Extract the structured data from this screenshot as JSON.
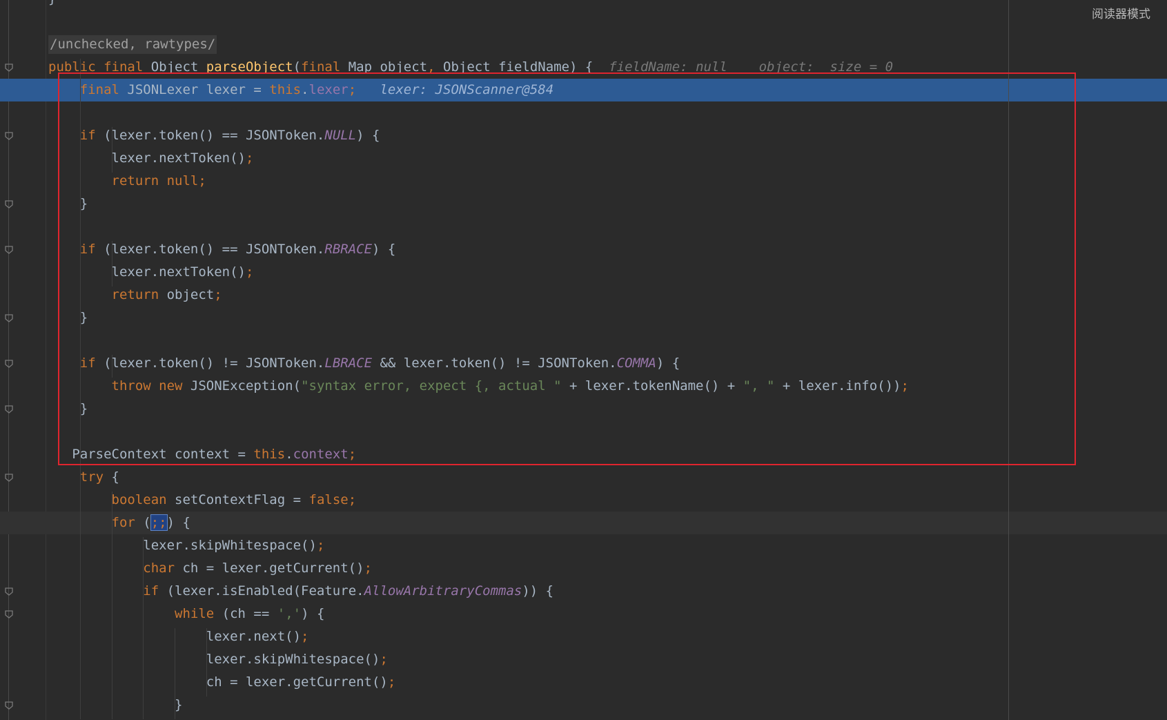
{
  "editor": {
    "reader_mode_label": "阅读器模式",
    "lines": [
      {
        "tokens": [
          {
            "t": "}",
            "c": ""
          }
        ]
      },
      {
        "tokens": []
      },
      {
        "annotation": "/unchecked, rawtypes/"
      },
      {
        "tokens": [
          {
            "t": "public final ",
            "c": "kw"
          },
          {
            "t": "Object ",
            "c": ""
          },
          {
            "t": "parseObject",
            "c": "fn"
          },
          {
            "t": "(",
            "c": ""
          },
          {
            "t": "final ",
            "c": "kw"
          },
          {
            "t": "Map object",
            "c": ""
          },
          {
            "t": ", ",
            "c": "kw"
          },
          {
            "t": "Object fieldName) {",
            "c": ""
          },
          {
            "t": "  fieldName: null    object:  size = 0",
            "c": "inl"
          }
        ]
      },
      {
        "highlight": "exec",
        "tokens": [
          {
            "t": "    final ",
            "c": "kw"
          },
          {
            "t": "JSONLexer lexer = ",
            "c": ""
          },
          {
            "t": "this",
            "c": "kw"
          },
          {
            "t": ".",
            "c": ""
          },
          {
            "t": "lexer",
            "c": "fld"
          },
          {
            "t": ";",
            "c": "kw"
          },
          {
            "t": "   lexer: JSONScanner@584",
            "c": "inl"
          }
        ]
      },
      {
        "tokens": []
      },
      {
        "tokens": [
          {
            "t": "    if ",
            "c": "kw"
          },
          {
            "t": "(lexer.token() == JSONToken.",
            "c": ""
          },
          {
            "t": "NULL",
            "c": "cst"
          },
          {
            "t": ") {",
            "c": ""
          }
        ]
      },
      {
        "tokens": [
          {
            "t": "        lexer.nextToken()",
            "c": ""
          },
          {
            "t": ";",
            "c": "kw"
          }
        ]
      },
      {
        "tokens": [
          {
            "t": "        return null;",
            "c": "kw"
          }
        ]
      },
      {
        "tokens": [
          {
            "t": "    }",
            "c": ""
          }
        ]
      },
      {
        "tokens": []
      },
      {
        "tokens": [
          {
            "t": "    if ",
            "c": "kw"
          },
          {
            "t": "(lexer.token() == JSONToken.",
            "c": ""
          },
          {
            "t": "RBRACE",
            "c": "cst"
          },
          {
            "t": ") {",
            "c": ""
          }
        ]
      },
      {
        "tokens": [
          {
            "t": "        lexer.nextToken()",
            "c": ""
          },
          {
            "t": ";",
            "c": "kw"
          }
        ]
      },
      {
        "tokens": [
          {
            "t": "        return ",
            "c": "kw"
          },
          {
            "t": "object",
            "c": ""
          },
          {
            "t": ";",
            "c": "kw"
          }
        ]
      },
      {
        "tokens": [
          {
            "t": "    }",
            "c": ""
          }
        ]
      },
      {
        "tokens": []
      },
      {
        "tokens": [
          {
            "t": "    if ",
            "c": "kw"
          },
          {
            "t": "(lexer.token() != JSONToken.",
            "c": ""
          },
          {
            "t": "LBRACE",
            "c": "cst"
          },
          {
            "t": " && lexer.token() != JSONToken.",
            "c": ""
          },
          {
            "t": "COMMA",
            "c": "cst"
          },
          {
            "t": ") {",
            "c": ""
          }
        ]
      },
      {
        "tokens": [
          {
            "t": "        throw new ",
            "c": "kw"
          },
          {
            "t": "JSONException(",
            "c": ""
          },
          {
            "t": "\"syntax error, expect {, actual \"",
            "c": "str"
          },
          {
            "t": " + lexer.tokenName() + ",
            "c": ""
          },
          {
            "t": "\", \"",
            "c": "str"
          },
          {
            "t": " + lexer.info())",
            "c": ""
          },
          {
            "t": ";",
            "c": "kw"
          }
        ]
      },
      {
        "tokens": [
          {
            "t": "    }",
            "c": ""
          }
        ]
      },
      {
        "tokens": []
      },
      {
        "tokens": [
          {
            "t": "   ParseContext context = ",
            "c": ""
          },
          {
            "t": "this",
            "c": "kw"
          },
          {
            "t": ".",
            "c": ""
          },
          {
            "t": "context",
            "c": "fld"
          },
          {
            "t": ";",
            "c": "kw"
          }
        ]
      },
      {
        "tokens": [
          {
            "t": "    try ",
            "c": "kw"
          },
          {
            "t": "{",
            "c": ""
          }
        ]
      },
      {
        "tokens": [
          {
            "t": "        boolean ",
            "c": "kw"
          },
          {
            "t": "setContextFlag = ",
            "c": ""
          },
          {
            "t": "false;",
            "c": "kw"
          }
        ]
      },
      {
        "highlight": "caret",
        "tokens": [
          {
            "t": "        for ",
            "c": "kw"
          },
          {
            "t": "(",
            "c": ""
          },
          {
            "t": ";;",
            "c": "kw sel"
          },
          {
            "t": ") {",
            "c": ""
          }
        ]
      },
      {
        "tokens": [
          {
            "t": "            lexer.skipWhitespace()",
            "c": ""
          },
          {
            "t": ";",
            "c": "kw"
          }
        ]
      },
      {
        "tokens": [
          {
            "t": "            char ",
            "c": "kw"
          },
          {
            "t": "ch = lexer.getCurrent()",
            "c": ""
          },
          {
            "t": ";",
            "c": "kw"
          }
        ]
      },
      {
        "tokens": [
          {
            "t": "            if ",
            "c": "kw"
          },
          {
            "t": "(lexer.isEnabled(Feature.",
            "c": ""
          },
          {
            "t": "AllowArbitraryCommas",
            "c": "cst"
          },
          {
            "t": ")) {",
            "c": ""
          }
        ]
      },
      {
        "tokens": [
          {
            "t": "                while ",
            "c": "kw"
          },
          {
            "t": "(ch == ",
            "c": ""
          },
          {
            "t": "','",
            "c": "str"
          },
          {
            "t": ") {",
            "c": ""
          }
        ]
      },
      {
        "tokens": [
          {
            "t": "                    lexer.next()",
            "c": ""
          },
          {
            "t": ";",
            "c": "kw"
          }
        ]
      },
      {
        "tokens": [
          {
            "t": "                    lexer.skipWhitespace()",
            "c": ""
          },
          {
            "t": ";",
            "c": "kw"
          }
        ]
      },
      {
        "tokens": [
          {
            "t": "                    ch = lexer.getCurrent()",
            "c": ""
          },
          {
            "t": ";",
            "c": "kw"
          }
        ]
      },
      {
        "tokens": [
          {
            "t": "                }",
            "c": ""
          }
        ]
      }
    ]
  }
}
